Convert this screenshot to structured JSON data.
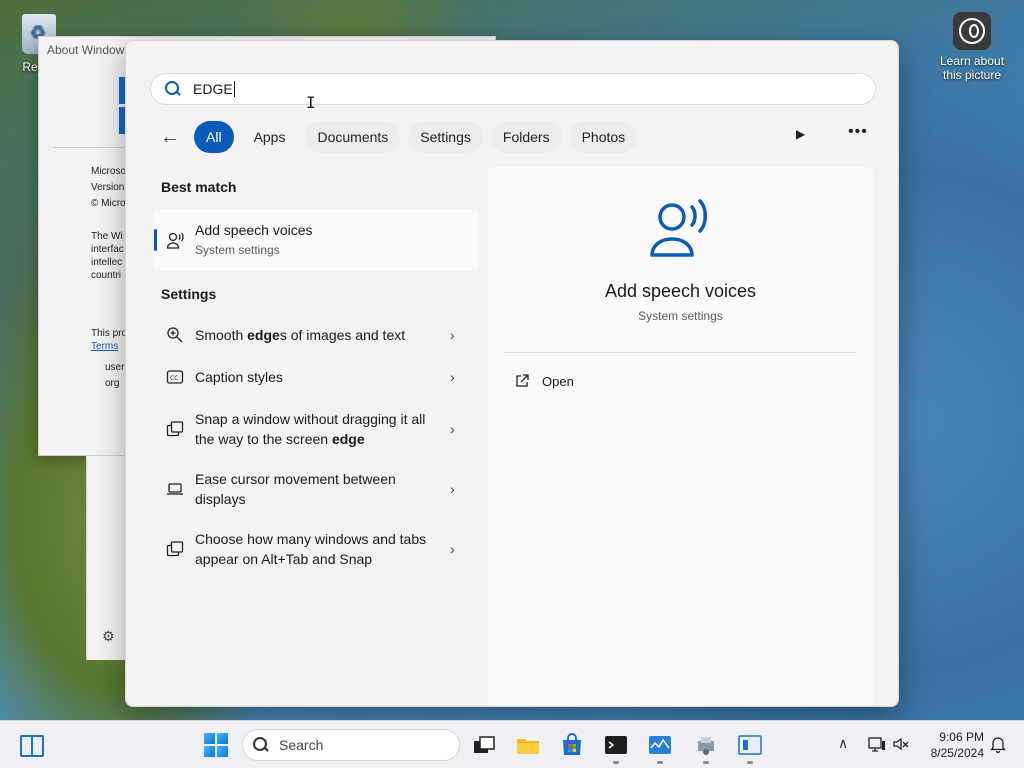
{
  "desktop": {
    "recycle_label": "Recyc",
    "learn_label": "Learn about this picture"
  },
  "about_window": {
    "title": "About Window",
    "lines": [
      "Microso",
      "Version",
      "© Micro"
    ],
    "para": [
      "The Wi",
      "interfac",
      "intellec",
      "countri"
    ],
    "license_line": "This pro",
    "terms_link": "Terms",
    "user_lines": [
      "user",
      "org"
    ]
  },
  "search": {
    "query": "EDGE",
    "filters": [
      "All",
      "Apps",
      "Documents",
      "Settings",
      "Folders",
      "Photos"
    ],
    "active_filter": "All",
    "best_match_heading": "Best match",
    "best_match": {
      "title": "Add speech voices",
      "subtitle": "System settings",
      "icon": "speech-voices-icon"
    },
    "settings_heading": "Settings",
    "settings": [
      {
        "pre": "Smooth ",
        "bold": "edge",
        "post": "s of images and text",
        "icon": "magnifier-plus-icon"
      },
      {
        "pre": "Caption styles",
        "bold": "",
        "post": "",
        "icon": "closed-caption-icon"
      },
      {
        "pre": "Snap a window without dragging it all the way to the screen ",
        "bold": "edge",
        "post": "",
        "icon": "snap-window-icon"
      },
      {
        "pre": "Ease cursor movement between displays",
        "bold": "",
        "post": "",
        "icon": "laptop-icon"
      },
      {
        "pre": "Choose how many windows and tabs appear on Alt+Tab and Snap",
        "bold": "",
        "post": "",
        "icon": "multitask-icon"
      }
    ],
    "detail": {
      "title": "Add speech voices",
      "subtitle": "System settings",
      "open_label": "Open"
    }
  },
  "taskbar": {
    "search_placeholder": "Search",
    "time": "9:06 PM",
    "date": "8/25/2024"
  },
  "colors": {
    "accent": "#0a5cb8",
    "flyout_bg": "#f3f3f3",
    "detail_bg": "#fafafa",
    "taskbar_bg": "#eef0f3"
  }
}
